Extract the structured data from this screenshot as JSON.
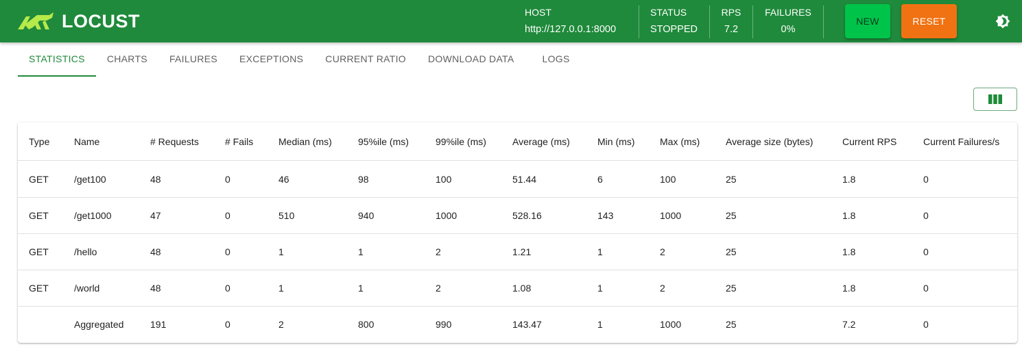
{
  "app": {
    "name": "LOCUST"
  },
  "header": {
    "host_label": "HOST",
    "host_value": "http://127.0.0.1:8000",
    "status_label": "STATUS",
    "status_value": "STOPPED",
    "rps_label": "RPS",
    "rps_value": "7.2",
    "failures_label": "FAILURES",
    "failures_value": "0%",
    "new_label": "NEW",
    "reset_label": "RESET",
    "theme_icon": "brightness-icon"
  },
  "tabs": [
    {
      "label": "STATISTICS",
      "active": true
    },
    {
      "label": "CHARTS"
    },
    {
      "label": "FAILURES"
    },
    {
      "label": "EXCEPTIONS"
    },
    {
      "label": "CURRENT RATIO"
    },
    {
      "label": "DOWNLOAD DATA"
    },
    {
      "label": "LOGS"
    }
  ],
  "columns_icon": "view-columns-icon",
  "colors": {
    "brand": "#1f8a3b",
    "new": "#00c34a",
    "reset": "#f07212"
  },
  "table": {
    "columns": [
      "Type",
      "Name",
      "# Requests",
      "# Fails",
      "Median (ms)",
      "95%ile (ms)",
      "99%ile (ms)",
      "Average (ms)",
      "Min (ms)",
      "Max (ms)",
      "Average size (bytes)",
      "Current RPS",
      "Current Failures/s"
    ],
    "rows": [
      [
        "GET",
        "/get100",
        "48",
        "0",
        "46",
        "98",
        "100",
        "51.44",
        "6",
        "100",
        "25",
        "1.8",
        "0"
      ],
      [
        "GET",
        "/get1000",
        "47",
        "0",
        "510",
        "940",
        "1000",
        "528.16",
        "143",
        "1000",
        "25",
        "1.8",
        "0"
      ],
      [
        "GET",
        "/hello",
        "48",
        "0",
        "1",
        "1",
        "2",
        "1.21",
        "1",
        "2",
        "25",
        "1.8",
        "0"
      ],
      [
        "GET",
        "/world",
        "48",
        "0",
        "1",
        "1",
        "2",
        "1.08",
        "1",
        "2",
        "25",
        "1.8",
        "0"
      ],
      [
        "",
        "Aggregated",
        "191",
        "0",
        "2",
        "800",
        "990",
        "143.47",
        "1",
        "1000",
        "25",
        "7.2",
        "0"
      ]
    ]
  }
}
